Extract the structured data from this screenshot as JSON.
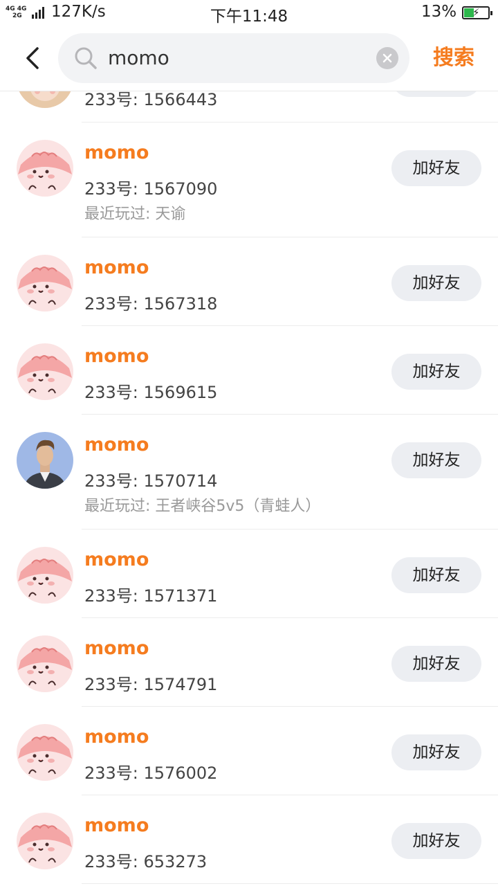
{
  "status_bar": {
    "network_top": "4G 4G",
    "network_bottom": "2G",
    "speed": "127K/s",
    "time": "下午11:48",
    "battery": "13%"
  },
  "search": {
    "query": "momo",
    "submit_label": "搜索"
  },
  "results": [
    {
      "name": "",
      "uid": "233号: 1566443",
      "recent": "",
      "add_label": "",
      "avatar": "photo-girl-icon"
    },
    {
      "name": "momo",
      "uid": "233号: 1567090",
      "recent": "最近玩过: 天谕",
      "add_label": "加好友",
      "avatar": "pink-blob-icon"
    },
    {
      "name": "momo",
      "uid": "233号: 1567318",
      "recent": "",
      "add_label": "加好友",
      "avatar": "pink-blob-icon"
    },
    {
      "name": "momo",
      "uid": "233号: 1569615",
      "recent": "",
      "add_label": "加好友",
      "avatar": "pink-blob-icon"
    },
    {
      "name": "momo",
      "uid": "233号: 1570714",
      "recent": "最近玩过: 王者峡谷5v5（青蛙人）",
      "add_label": "加好友",
      "avatar": "man-portrait-icon"
    },
    {
      "name": "momo",
      "uid": "233号: 1571371",
      "recent": "",
      "add_label": "加好友",
      "avatar": "pink-blob-icon"
    },
    {
      "name": "momo",
      "uid": "233号: 1574791",
      "recent": "",
      "add_label": "加好友",
      "avatar": "pink-blob-icon"
    },
    {
      "name": "momo",
      "uid": "233号: 1576002",
      "recent": "",
      "add_label": "加好友",
      "avatar": "pink-blob-icon"
    },
    {
      "name": "momo",
      "uid": "233号: 653273",
      "recent": "",
      "add_label": "加好友",
      "avatar": "pink-blob-icon"
    }
  ],
  "colors": {
    "accent": "#f57c1f",
    "button_bg": "#eceef2",
    "battery": "#2db84c"
  }
}
